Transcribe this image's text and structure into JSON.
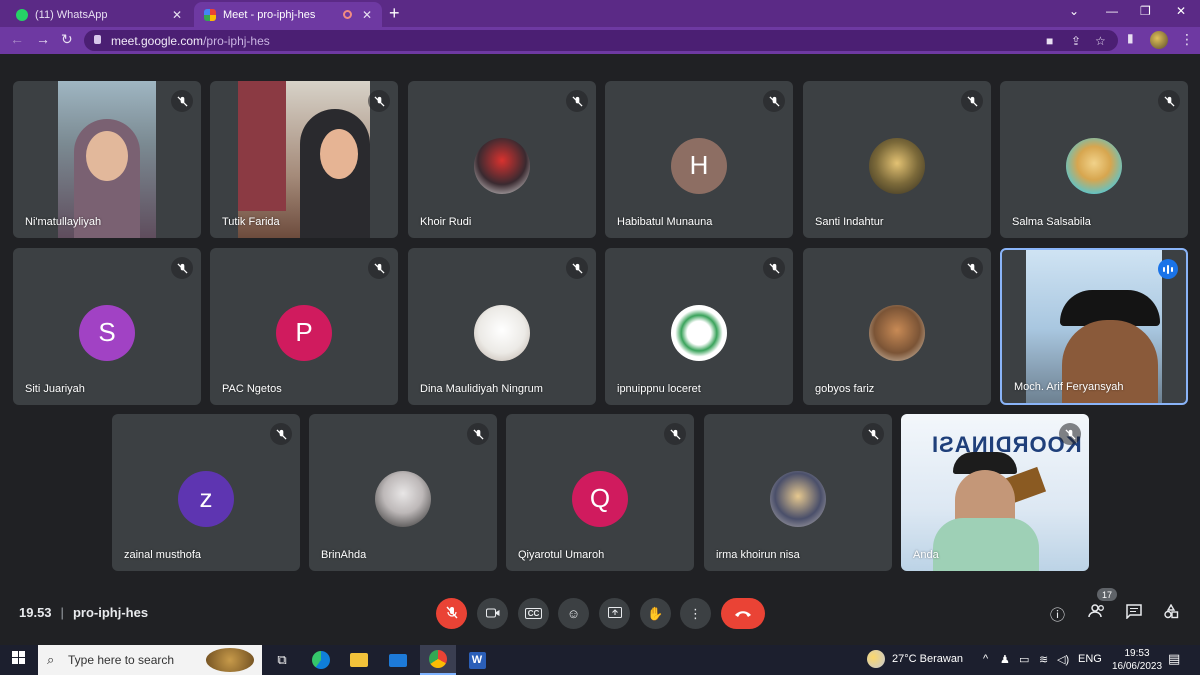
{
  "browser": {
    "tabs": [
      {
        "label": "(11) WhatsApp",
        "favicon": "whatsapp-icon",
        "active": false
      },
      {
        "label": "Meet - pro-iphj-hes",
        "favicon": "google-meet-icon",
        "active": true
      }
    ],
    "url_host": "meet.google.com",
    "url_path": "/pro-iphj-hes"
  },
  "meeting": {
    "time": "19.53",
    "code": "pro-iphj-hes",
    "participant_count": "17"
  },
  "participants": [
    {
      "name": "Ni'matullayliyah",
      "muted": true,
      "tile": "video"
    },
    {
      "name": "Tutik Farida",
      "muted": true,
      "tile": "video"
    },
    {
      "name": "Khoir Rudi",
      "muted": true,
      "tile": "photo"
    },
    {
      "name": "Habibatul Munauna",
      "muted": true,
      "tile": "initial",
      "initial": "H",
      "color": "#8d6e63"
    },
    {
      "name": "Santi Indahtur",
      "muted": true,
      "tile": "photo"
    },
    {
      "name": "Salma Salsabila",
      "muted": true,
      "tile": "photo"
    },
    {
      "name": "Siti Juariyah",
      "muted": true,
      "tile": "initial",
      "initial": "S",
      "color": "#a142c4"
    },
    {
      "name": "PAC Ngetos",
      "muted": true,
      "tile": "initial",
      "initial": "P",
      "color": "#d01b5e"
    },
    {
      "name": "Dina Maulidiyah Ningrum",
      "muted": true,
      "tile": "photo"
    },
    {
      "name": "ipnuippnu loceret",
      "muted": true,
      "tile": "photo"
    },
    {
      "name": "gobyos fariz",
      "muted": true,
      "tile": "photo"
    },
    {
      "name": "Moch. Arif Feryansyah",
      "muted": false,
      "speaking": true,
      "tile": "video"
    },
    {
      "name": "zainal musthofa",
      "muted": true,
      "tile": "initial",
      "initial": "z",
      "color": "#5e35b1"
    },
    {
      "name": "BrinAhda",
      "muted": true,
      "tile": "photo"
    },
    {
      "name": "Qiyarotul Umaroh",
      "muted": true,
      "tile": "initial",
      "initial": "Q",
      "color": "#d01b5e"
    },
    {
      "name": "irma khoirun nisa",
      "muted": true,
      "tile": "photo"
    },
    {
      "name": "Anda",
      "muted": true,
      "tile": "video",
      "background_text": "KOORDINASI"
    }
  ],
  "controls": {
    "mic": "mic-off-icon",
    "camera": "camera-icon",
    "captions": "CC",
    "emoji": "emoji-icon",
    "present": "present-icon",
    "hand": "raise-hand-icon",
    "more": "more-vert-icon",
    "leave": "hang-up-icon"
  },
  "taskbar": {
    "search_placeholder": "Type here to search",
    "weather": "27°C  Berawan",
    "language": "ENG",
    "clock_time": "19:53",
    "clock_date": "16/06/2023"
  },
  "colors": {
    "meet_bg": "#202124",
    "tile_bg": "#3c4043",
    "leave_red": "#ea4335",
    "browser_purple": "#6e39a2",
    "speaking_blue": "#1a73e8"
  }
}
